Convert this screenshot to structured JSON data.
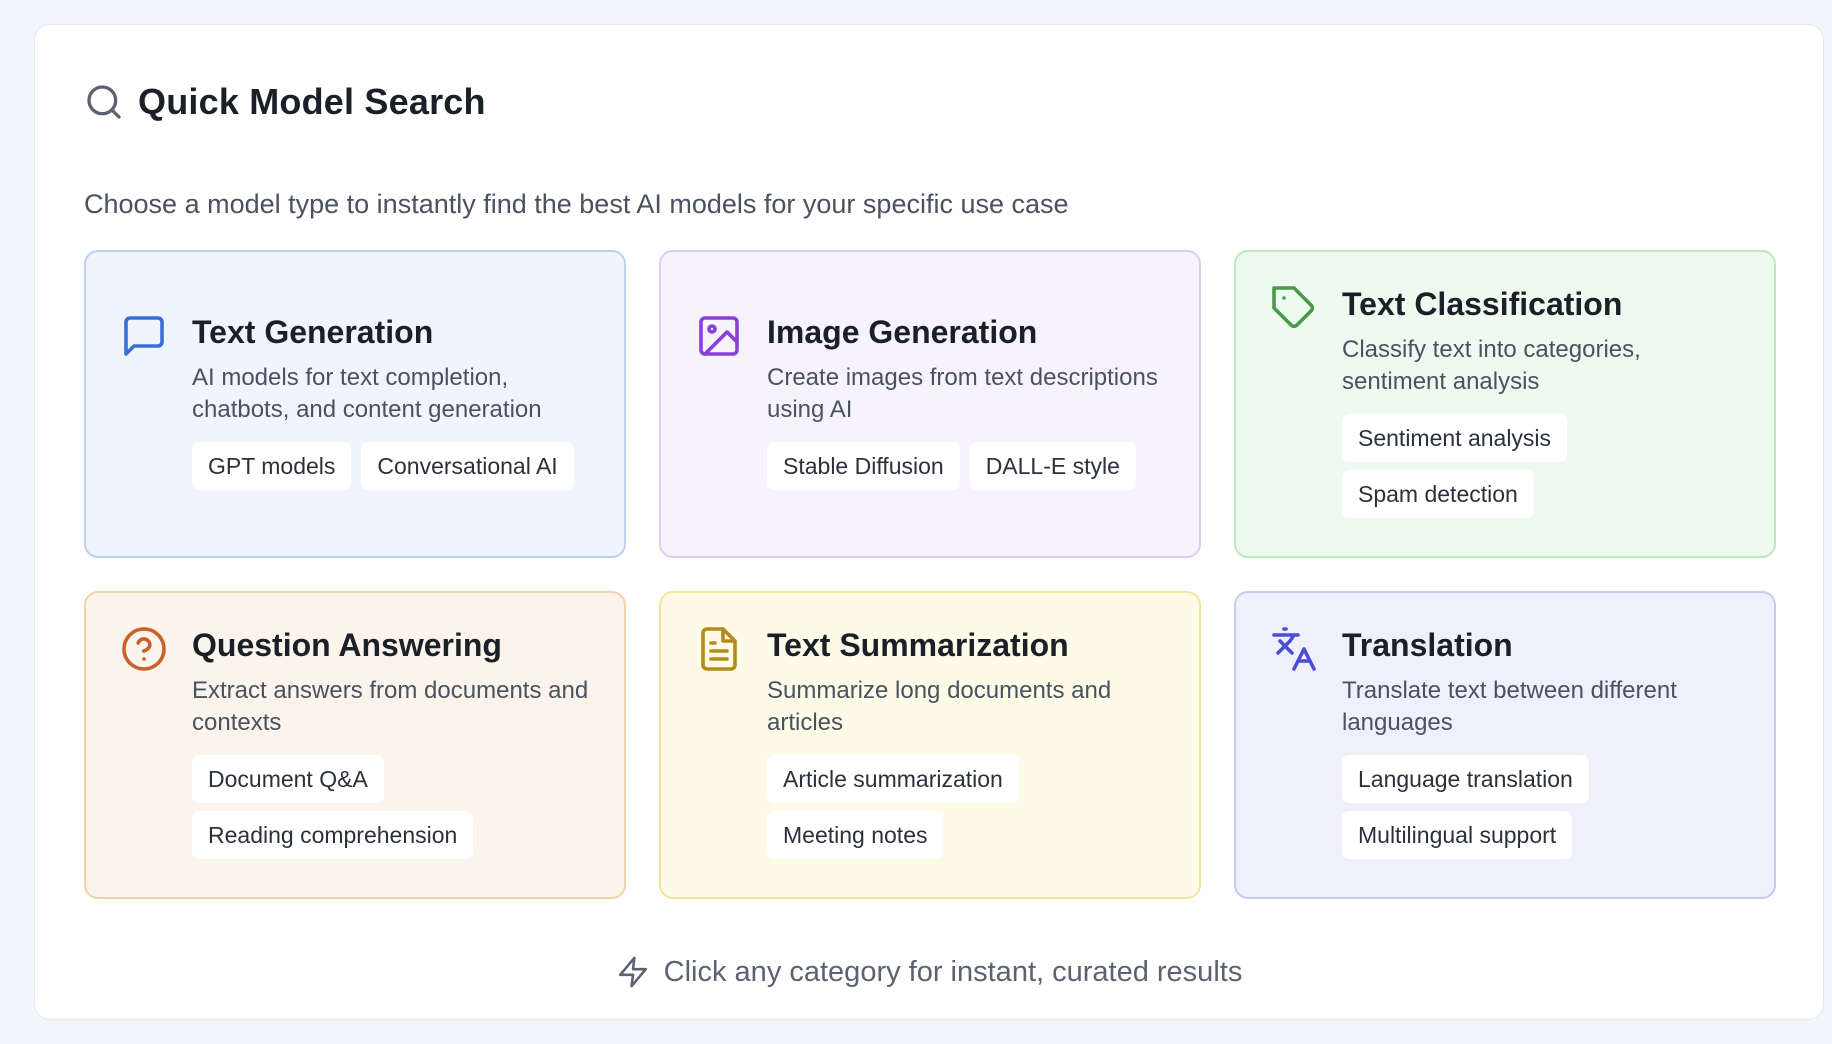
{
  "header": {
    "title": "Quick Model Search",
    "subtitle": "Choose a model type to instantly find the best AI models for your specific use case",
    "icon": "search-icon"
  },
  "cards": [
    {
      "title": "Text Generation",
      "description": "AI models for text completion, chatbots, and content generation",
      "tags": [
        "GPT models",
        "Conversational AI"
      ],
      "icon": "message-square-icon",
      "accent": "#3a6fd8",
      "background": "#eff4fd",
      "border": "#bcd0f2"
    },
    {
      "title": "Image Generation",
      "description": "Create images from text descriptions using AI",
      "tags": [
        "Stable Diffusion",
        "DALL-E style"
      ],
      "icon": "image-icon",
      "accent": "#8a3fd6",
      "background": "#f7f3fd",
      "border": "#ddcdf3"
    },
    {
      "title": "Text Classification",
      "description": "Classify text into categories, sentiment analysis",
      "tags": [
        "Sentiment analysis",
        "Spam detection"
      ],
      "icon": "tag-icon",
      "accent": "#4a9a4e",
      "background": "#eefaef",
      "border": "#bfe8c2"
    },
    {
      "title": "Question Answering",
      "description": "Extract answers from documents and contexts",
      "tags": [
        "Document Q&A",
        "Reading comprehension"
      ],
      "icon": "help-circle-icon",
      "accent": "#c8612a",
      "background": "#fbf4ec",
      "border": "#f2d2aa"
    },
    {
      "title": "Text Summarization",
      "description": "Summarize long documents and articles",
      "tags": [
        "Article summarization",
        "Meeting notes"
      ],
      "icon": "file-text-icon",
      "accent": "#b58a1a",
      "background": "#fdfbe8",
      "border": "#f3e59a"
    },
    {
      "title": "Translation",
      "description": "Translate text between different languages",
      "tags": [
        "Language translation",
        "Multilingual support"
      ],
      "icon": "languages-icon",
      "accent": "#4a4fd0",
      "background": "#eff0fb",
      "border": "#c7cbf2"
    }
  ],
  "footer": {
    "text": "Click any category for instant, curated results",
    "icon": "zap-icon"
  }
}
